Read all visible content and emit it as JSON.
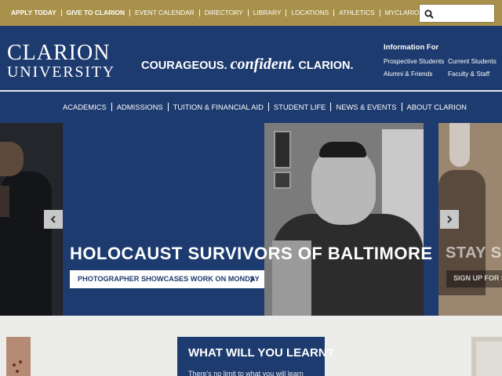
{
  "utility_bar": {
    "links": [
      {
        "label": "APPLY TODAY",
        "bold": true
      },
      {
        "label": "GIVE TO CLARION",
        "bold": true
      },
      {
        "label": "EVENT CALENDAR",
        "bold": false
      },
      {
        "label": "DIRECTORY",
        "bold": false
      },
      {
        "label": "LIBRARY",
        "bold": false
      },
      {
        "label": "LOCATIONS",
        "bold": false
      },
      {
        "label": "ATHLETICS",
        "bold": false
      },
      {
        "label": "MYCLARION TOOLS",
        "bold": false
      }
    ],
    "search": {
      "placeholder": "",
      "icon": "search-icon"
    }
  },
  "header": {
    "logo_line1": "CLARION",
    "logo_line2": "UNIVERSITY",
    "tagline_part1": "COURAGEOUS.",
    "tagline_part2": "confident.",
    "tagline_part3": "CLARION.",
    "info_title": "Information For",
    "info_links": [
      "Prospective Students",
      "Current Students",
      "Alumni & Friends",
      "Faculty & Staff"
    ]
  },
  "main_nav": {
    "items": [
      "ACADEMICS",
      "ADMISSIONS",
      "TUITION & FINANCIAL AID",
      "STUDENT LIFE",
      "NEWS & EVENTS",
      "ABOUT CLARION"
    ]
  },
  "hero": {
    "headline": "HOLOCAUST SURVIVORS OF BALTIMORE",
    "cta_label": "PHOTOGRAPHER SHOWCASES WORK ON MONDAY",
    "next_headline": "STAY SH",
    "next_cta_label": "SIGN UP FOR S",
    "prev_icon": "chevron-left-icon",
    "next_icon": "chevron-right-icon"
  },
  "learn": {
    "title": "WHAT WILL YOU LEARN?",
    "subtitle": "There's no limit to what you will learn"
  },
  "colors": {
    "gold": "#a8914a",
    "navy": "#1d3b6f",
    "white": "#ffffff"
  }
}
